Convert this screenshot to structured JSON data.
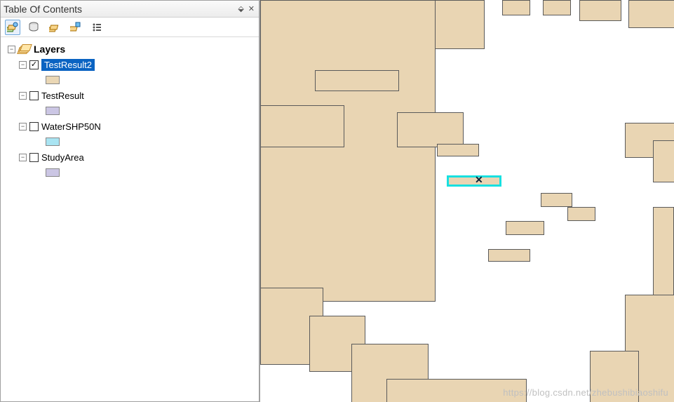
{
  "panel": {
    "title": "Table Of Contents",
    "pin_glyph": "⬙",
    "close_glyph": "✕"
  },
  "toolbar": {
    "btn1_title": "List By Drawing Order",
    "btn2_title": "List By Source",
    "btn3_title": "List By Visibility",
    "btn4_title": "List By Selection",
    "btn5_title": "Options"
  },
  "tree": {
    "root_label": "Layers",
    "layers": [
      {
        "name": "TestResult2",
        "swatch": "#ead7b5",
        "checked": true,
        "selected": true
      },
      {
        "name": "TestResult",
        "swatch": "#cbc6e4",
        "checked": false,
        "selected": false
      },
      {
        "name": "WaterSHP50N",
        "swatch": "#a9e4f2",
        "checked": false,
        "selected": false
      },
      {
        "name": "StudyArea",
        "swatch": "#cbc6e4",
        "checked": false,
        "selected": false
      }
    ]
  },
  "map": {
    "watermark": "https://blog.csdn.net/zhebushibiaoshifu"
  }
}
